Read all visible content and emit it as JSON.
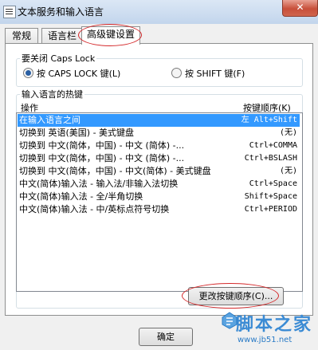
{
  "window": {
    "title": "文本服务和输入语言",
    "close_glyph": "✕"
  },
  "tabs": [
    {
      "label": "常规"
    },
    {
      "label": "语言栏"
    },
    {
      "label": "高级键设置"
    }
  ],
  "caps_group": {
    "legend": "要关闭 Caps Lock",
    "option_caps": "按 CAPS LOCK 键(L)",
    "option_shift": "按 SHIFT 键(F)"
  },
  "hotkey_group": {
    "legend": "输入语言的热键",
    "col_action": "操作",
    "col_key": "按键顺序(K)",
    "rows": [
      {
        "action": "在输入语言之间",
        "key": "左 Alt+Shift",
        "selected": true
      },
      {
        "action": "切换到 英语(美国) - 美式键盘",
        "key": "(无)"
      },
      {
        "action": "切换到 中文(简体，中国) - 中文 (简体) -...",
        "key": "Ctrl+COMMA"
      },
      {
        "action": "切换到 中文(简体，中国) - 中文 (简体) -...",
        "key": "Ctrl+BSLASH"
      },
      {
        "action": "切换到 中文(简体，中国) - 中文(简体) - 美式键盘",
        "key": "(无)"
      },
      {
        "action": "中文(简体)输入法 - 输入法/非输入法切换",
        "key": "Ctrl+Space"
      },
      {
        "action": "中文(简体)输入法 - 全/半角切换",
        "key": "Shift+Space"
      },
      {
        "action": "中文(简体)输入法 - 中/英标点符号切换",
        "key": "Ctrl+PERIOD"
      }
    ],
    "change_button": "更改按键顺序(C)..."
  },
  "footer": {
    "ok_button": "确定"
  },
  "watermark": {
    "text": "脚本之家",
    "url": "www.jb51.net"
  }
}
